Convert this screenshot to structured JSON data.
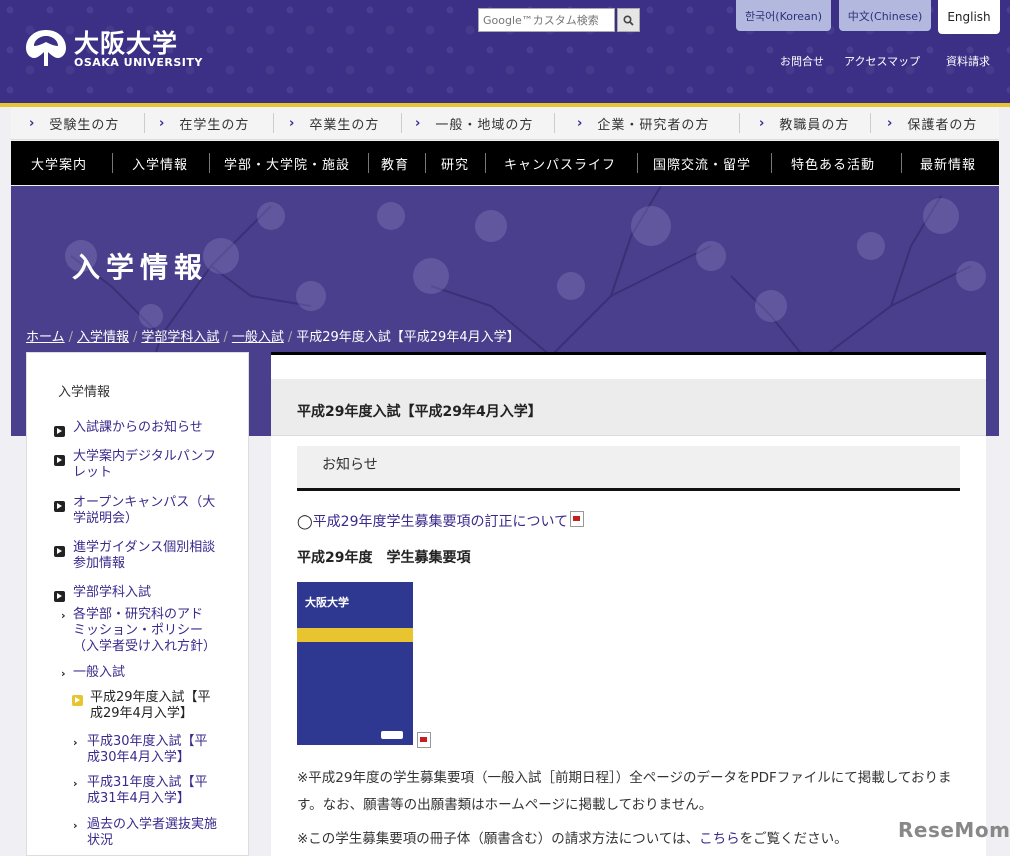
{
  "header": {
    "logo_ja": "大阪大学",
    "logo_en": "OSAKA UNIVERSITY",
    "search_placeholder": "Google™カスタム検索",
    "languages": [
      "한국어(Korean)",
      "中文(Chinese)",
      "English"
    ],
    "utility_links": [
      "お問合せ",
      "アクセスマップ",
      "資料請求"
    ]
  },
  "audience_nav": [
    "受験生の方",
    "在学生の方",
    "卒業生の方",
    "一般・地域の方",
    "企業・研究者の方",
    "教職員の方",
    "保護者の方"
  ],
  "main_nav": [
    "大学案内",
    "入学情報",
    "学部・大学院・施設",
    "教育",
    "研究",
    "キャンパスライフ",
    "国際交流・留学",
    "特色ある活動",
    "最新情報"
  ],
  "hero": {
    "title": "入学情報"
  },
  "breadcrumb": {
    "links": [
      "ホーム",
      "入学情報",
      "学部学科入試",
      "一般入試"
    ],
    "current": "平成29年度入試【平成29年4月入学】"
  },
  "sidebar": {
    "title": "入学情報",
    "items": [
      {
        "label": "入試課からのお知らせ"
      },
      {
        "label_lines": [
          "大学案内デジタルパンフ",
          "レット"
        ]
      },
      {
        "label_lines": [
          "オープンキャンパス（大",
          "学説明会）"
        ]
      },
      {
        "label_lines": [
          "進学ガイダンス個別相談",
          "参加情報"
        ]
      },
      {
        "label": "学部学科入試"
      }
    ],
    "sub_items": [
      {
        "label_lines": [
          "各学部・研究科のアド",
          "ミッション・ポリシー",
          "（入学者受け入れ方針）"
        ]
      },
      {
        "label": "一般入試"
      }
    ],
    "sub_sub_items": [
      {
        "label_lines": [
          "平成29年度入試【平",
          "成29年4月入学】"
        ],
        "active": true
      },
      {
        "label_lines": [
          "平成30年度入試【平",
          "成30年4月入学】"
        ]
      },
      {
        "label_lines": [
          "平成31年度入試【平",
          "成31年4月入学】"
        ]
      },
      {
        "label_lines": [
          "過去の入学者選抜実施",
          "状況"
        ]
      }
    ]
  },
  "content": {
    "heading": "平成29年度入試【平成29年4月入学】",
    "notice_heading": "お知らせ",
    "correction_prefix": "◯",
    "correction_link": "平成29年度学生募集要項の訂正について",
    "subheading": "平成29年度　学生募集要項",
    "booklet_title": "大阪大学",
    "note1": "※平成29年度の学生募集要項（一般入試［前期日程］）全ページのデータをPDFファイルにて掲載しております。なお、願書等の出願書類はホームページに掲載しておりません。",
    "note2_prefix": "※この学生募集要項の冊子体（願書含む）の請求方法については、",
    "note2_link": "こちら",
    "note2_suffix": "をご覧ください。"
  },
  "watermark": "ReseMom",
  "colors": {
    "brand_purple": "#3b2f86",
    "gold": "#e8c530",
    "link": "#3a2a8c"
  }
}
